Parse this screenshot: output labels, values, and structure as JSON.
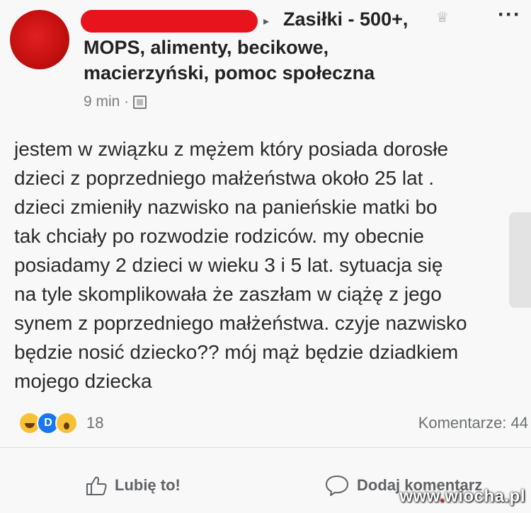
{
  "header": {
    "group_line1": "Zasiłki - 500+,",
    "group_line2": "MOPS, alimenty, becikowe,",
    "group_line3": "macierzyński, pomoc społeczna",
    "timestamp": "9 min ·",
    "arrow": "▸",
    "more": "···",
    "group_icon_glyph": "♕"
  },
  "post": {
    "lines": [
      "jestem w związku z mężem który posiada dorosłe",
      "dzieci z poprzedniego małżeństwa około 25 lat .",
      "dzieci zmieniły nazwisko na panieńskie matki bo",
      "tak chciały po rozwodzie rodziców. my obecnie",
      "posiadamy 2 dzieci w wieku 3 i 5 lat. sytuacja się",
      "na tyle skomplikowała że zaszłam w ciążę z jego",
      "synem z poprzedniego małżeństwa. czyje nazwisko",
      "będzie nosić dziecko?? mój mąż będzie dziadkiem",
      "mojego dziecka"
    ]
  },
  "stats": {
    "reaction_count": "18",
    "comments": "Komentarze: 44"
  },
  "actions": {
    "like": "Lubię to!",
    "comment": "Dodaj komentarz"
  },
  "watermark": {
    "text1": "www",
    "dot": ".",
    "text2": "wiocha.pl"
  },
  "colors": {
    "redaction": "#e8141c",
    "like_blue": "#1877f2",
    "emoji_yellow": "#f7c136"
  }
}
